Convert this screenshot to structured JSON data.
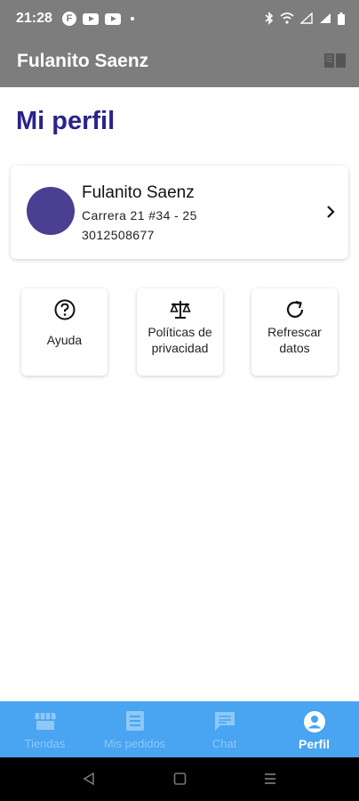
{
  "status_bar": {
    "time": "21:28",
    "f_icon_letter": "F"
  },
  "app_bar": {
    "title": "Fulanito Saenz",
    "action_icon": "book-icon"
  },
  "page": {
    "title": "Mi perfil"
  },
  "profile": {
    "name": "Fulanito Saenz",
    "address": "Carrera 21 #34 - 25",
    "phone": "3012508677",
    "avatar_color": "#4a3f91"
  },
  "actions": [
    {
      "label_line1": "Ayuda",
      "label_line2": "",
      "icon": "help-circle-icon"
    },
    {
      "label_line1": "Políticas de",
      "label_line2": "privacidad",
      "icon": "scale-icon"
    },
    {
      "label_line1": "Refrescar",
      "label_line2": "datos",
      "icon": "refresh-icon"
    }
  ],
  "bottom_nav": [
    {
      "label": "Tiendas",
      "icon": "store-icon",
      "active": false
    },
    {
      "label": "Mis pedidos",
      "icon": "list-icon",
      "active": false
    },
    {
      "label": "Chat",
      "icon": "chat-icon",
      "active": false
    },
    {
      "label": "Perfil",
      "icon": "profile-icon",
      "active": true
    }
  ],
  "colors": {
    "app_bar": "#7d7d7d",
    "title_accent": "#2a238a",
    "bottom_nav": "#49a4f2",
    "nav_inactive": "#8ec8f7",
    "nav_active": "#ffffff"
  }
}
